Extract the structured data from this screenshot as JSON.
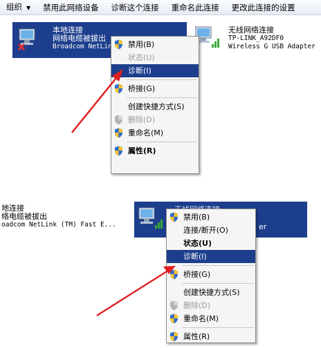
{
  "toolbar": {
    "organize": "组织",
    "items": [
      "禁用此网络设备",
      "诊断这个连接",
      "重命名此连接",
      "更改此连接的设置"
    ]
  },
  "top": {
    "local": {
      "name": "本地连接",
      "status": "网络电缆被拔出",
      "device": "Broadcom NetLink"
    },
    "wireless": {
      "name": "无线网络连接",
      "ssid": "TP-LINK_A92DF0",
      "device": "Wireless G USB Adapter"
    },
    "menu": {
      "disable": "禁用(B)",
      "status": "状态(U)",
      "diagnose": "诊断(I)",
      "bridge": "桥接(G)",
      "shortcut": "创建快捷方式(S)",
      "delete": "删除(D)",
      "rename": "重命名(M)",
      "properties": "属性(R)"
    }
  },
  "bottom": {
    "local": {
      "name": "地连接",
      "status": "络电缆被拔出",
      "device": "oadcom NetLink (TM) Fast E..."
    },
    "wireless": {
      "name": "无线网络连接",
      "device_tail": "er"
    },
    "menu": {
      "disable": "禁用(B)",
      "connect": "连接/断开(O)",
      "status": "状态(U)",
      "diagnose": "诊断(I)",
      "bridge": "桥接(G)",
      "shortcut": "创建快捷方式(S)",
      "delete": "删除(D)",
      "rename": "重命名(M)",
      "properties": "属性(R)"
    }
  },
  "colors": {
    "selection": "#1d3e8d",
    "arrow": "#e02020",
    "shield_blue": "#2f6ad0",
    "shield_yellow": "#f2c230"
  }
}
